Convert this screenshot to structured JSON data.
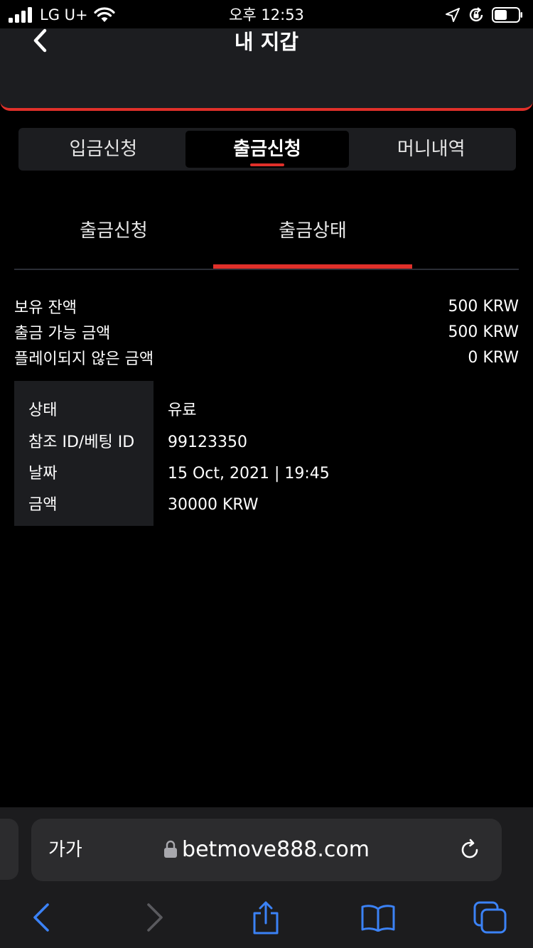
{
  "status_bar": {
    "carrier": "LG U+",
    "time": "오후 12:53"
  },
  "header": {
    "title": "내 지갑"
  },
  "main_tabs": [
    {
      "label": "입금신청",
      "active": false
    },
    {
      "label": "출금신청",
      "active": true
    },
    {
      "label": "머니내역",
      "active": false
    }
  ],
  "sub_tabs": [
    {
      "label": "출금신청",
      "active": false
    },
    {
      "label": "출금상태",
      "active": true
    }
  ],
  "balances": [
    {
      "label": "보유 잔액",
      "value": "500 KRW"
    },
    {
      "label": "출금 가능 금액",
      "value": "500 KRW"
    },
    {
      "label": "플레이되지 않은 금액",
      "value": "0 KRW"
    }
  ],
  "details": [
    {
      "label": "상태",
      "value": "유료"
    },
    {
      "label": "참조 ID/베팅 ID",
      "value": "99123350"
    },
    {
      "label": "날짜",
      "value": "15 Oct, 2021 | 19:45"
    },
    {
      "label": "금액",
      "value": "30000 KRW"
    }
  ],
  "browser": {
    "text_size_label": "가가",
    "url": "betmove888.com"
  },
  "colors": {
    "accent": "#e0302a",
    "surface": "#1c1d20",
    "safari_blue": "#3b82f6"
  }
}
